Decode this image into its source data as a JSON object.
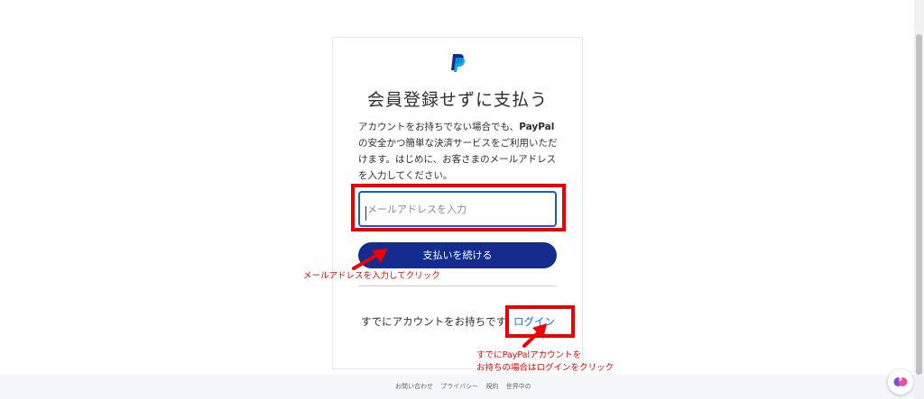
{
  "colors": {
    "brand_dark": "#142c8e",
    "brand_light": "#009cde",
    "annotation_red": "#ee0000",
    "link_blue": "#1a6fd1"
  },
  "icons": {
    "logo": "paypal-logo",
    "assistant": "ai-assistant-icon"
  },
  "card": {
    "title": "会員登録せずに支払う",
    "desc_before": "アカウントをお持ちでない場合でも、",
    "desc_brand": "PayPal",
    "desc_after": "の安全かつ簡単な決済サービスをご利用いただけます。はじめに、お客さまのメールアドレスを入力してください。",
    "email_placeholder": "メールアドレスを入力",
    "email_value": "",
    "continue_label": "支払いを続ける",
    "already_text": "すでにアカウントをお持ちです。",
    "login_label": "ログイン"
  },
  "annotations": {
    "note_email": "メールアドレスを入力してクリック",
    "note_login_line1": "すでにPayPalアカウントを",
    "note_login_line2": "お持ちの場合はログインをクリック"
  },
  "footer": {
    "links": [
      "お問い合わせ",
      "プライバシー",
      "規約",
      "世界中の"
    ]
  }
}
